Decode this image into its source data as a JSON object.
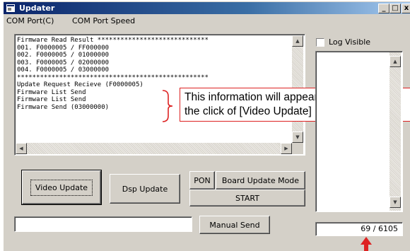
{
  "window": {
    "title": "Updater"
  },
  "titlebar": {
    "minimize": "_",
    "maximize": "□",
    "close": "x"
  },
  "menu": {
    "com_port": "COM Port(C)",
    "com_speed": "COM Port Speed"
  },
  "log": {
    "lines": [
      "Firmware Read Result *****************************",
      "001. F0000005 / FF000000",
      "002. F0000005 / 01000000",
      "003. F0000005 / 02000000",
      "004. F0000005 / 03000000",
      "**************************************************",
      "Update Request Recieve (F0000005)",
      "Firmware List Send",
      "Firmware List Send",
      "Firmware Send (03000000)"
    ]
  },
  "log_visible": {
    "label": "Log Visible",
    "checked": false
  },
  "buttons": {
    "video_update": "Video Update",
    "dsp_update": "Dsp Update",
    "pon": "PON",
    "board_update_mode": "Board Update Mode",
    "start": "START",
    "manual_send": "Manual Send"
  },
  "manual_send_input": {
    "value": ""
  },
  "progress": {
    "text": "69 / 6105",
    "current": 69,
    "total": 6105
  },
  "callout": {
    "line1": "This information will appear when",
    "line2": "the click of [Video Update] is acce"
  },
  "colors": {
    "annotation": "#dd2222",
    "titlebar": "#0a246a"
  }
}
